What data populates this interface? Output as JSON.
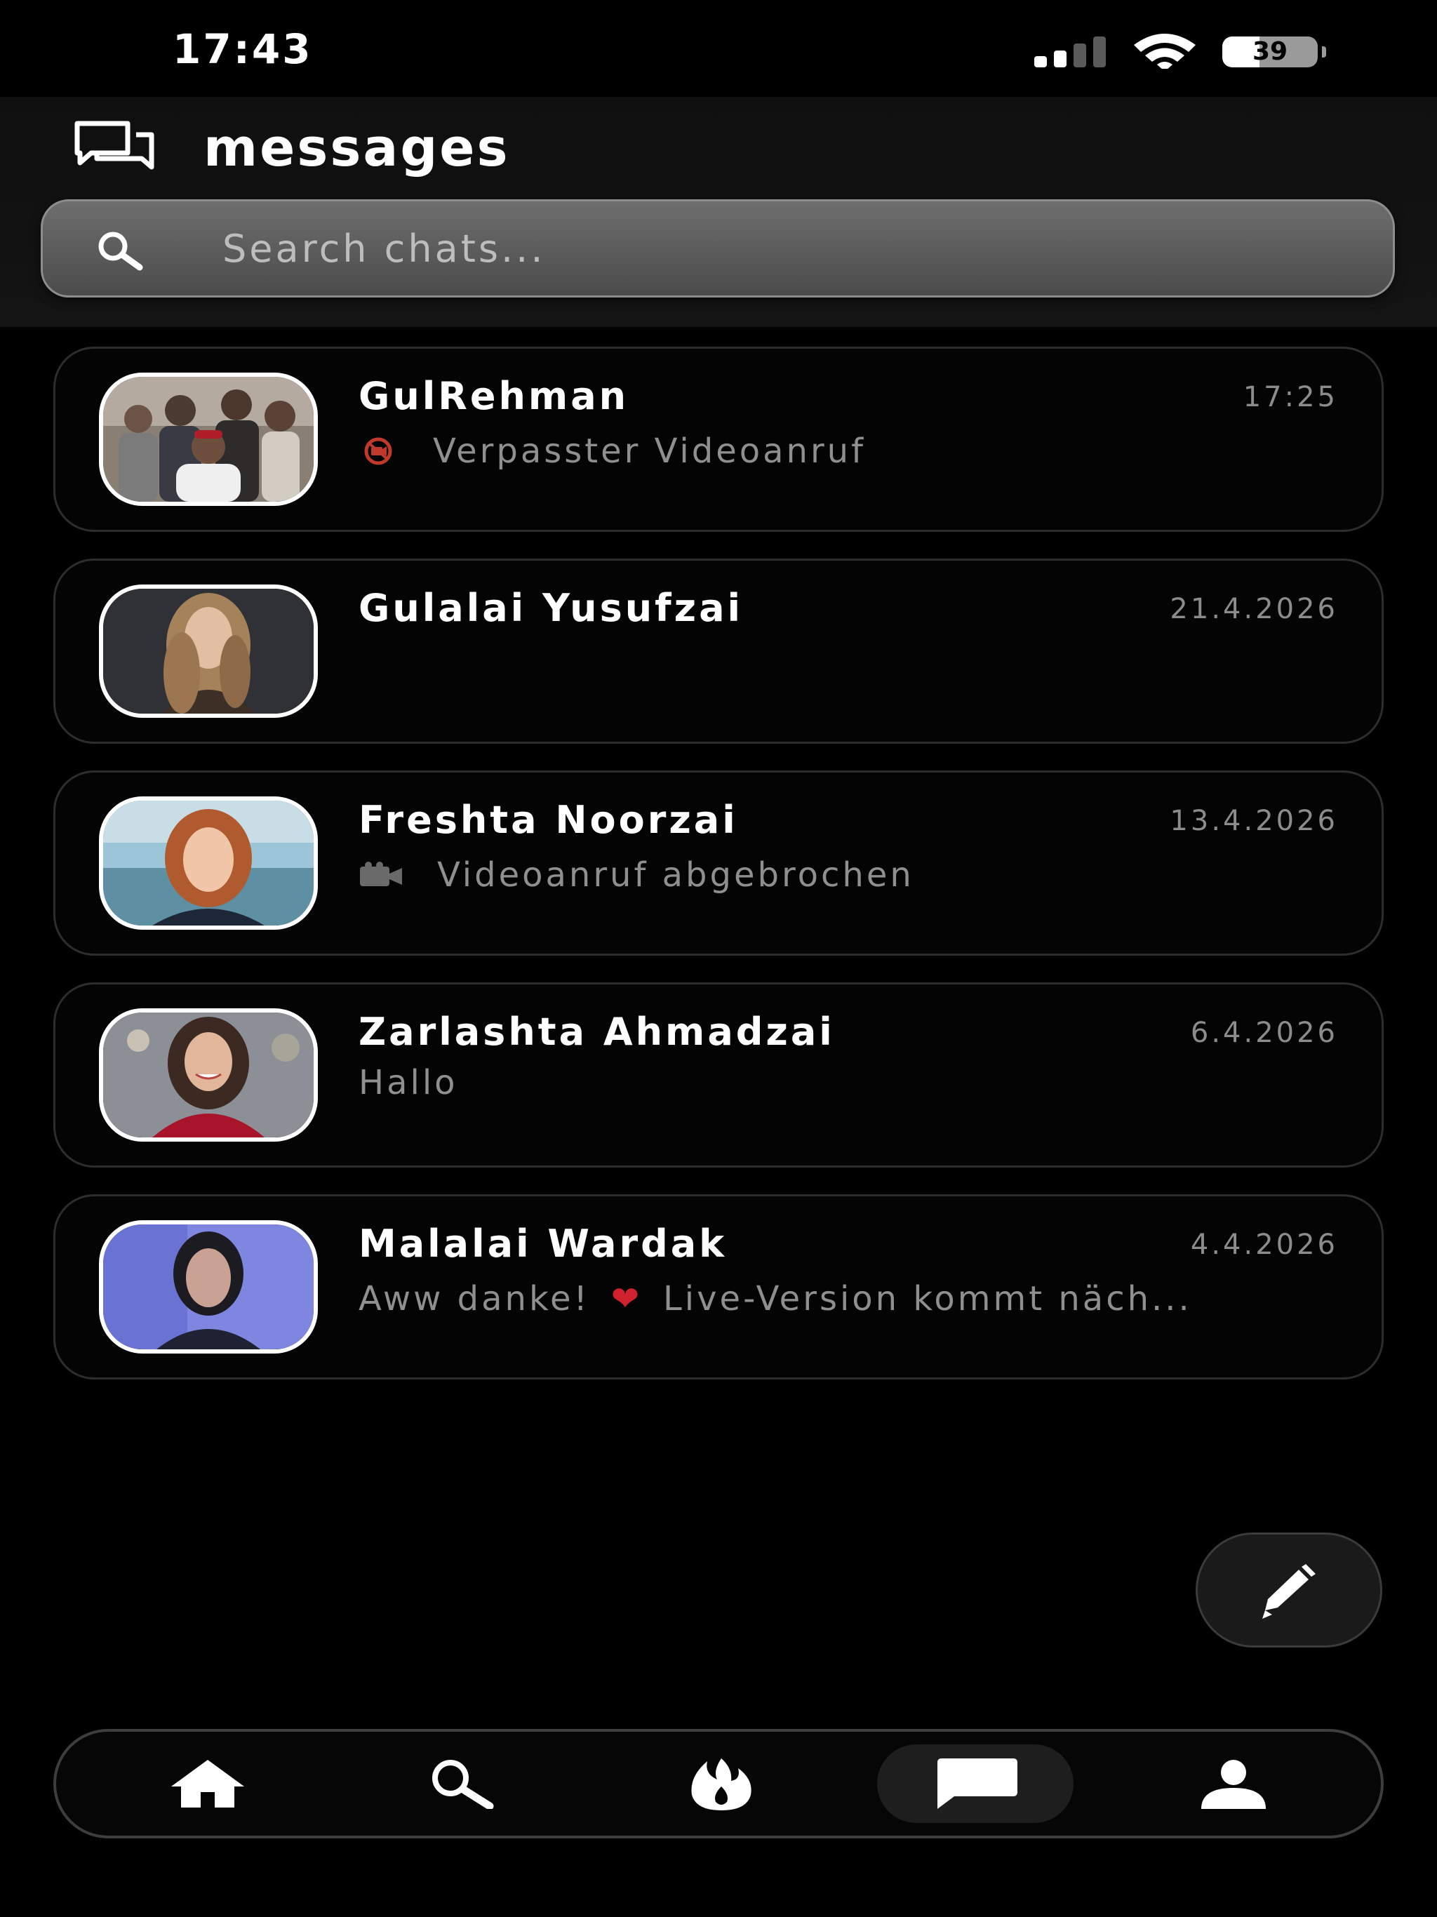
{
  "status_bar": {
    "time": "17:43",
    "battery_level": "39",
    "battery_fraction": 0.39
  },
  "header": {
    "title": "messages",
    "icon": "chat-bubbles-icon"
  },
  "search": {
    "placeholder": "Search chats...",
    "value": ""
  },
  "chats": [
    {
      "name": "GulRehman",
      "time": "17:25",
      "preview_icon": "missed-video-call-icon",
      "preview": "Verpasster Videoanruf"
    },
    {
      "name": "Gulalai Yusufzai",
      "time": "21.4.2026",
      "preview": ""
    },
    {
      "name": "Freshta Noorzai",
      "time": "13.4.2026",
      "preview_icon": "video-camera-icon",
      "preview": "Videoanruf abgebrochen"
    },
    {
      "name": "Zarlashta Ahmadzai",
      "time": "6.4.2026",
      "preview": "Hallo"
    },
    {
      "name": "Malalai Wardak",
      "time": "4.4.2026",
      "preview_before": "Aww danke!",
      "preview_emoji": "❤",
      "preview_after": "Live-Version kommt näch..."
    }
  ],
  "fab": {
    "icon": "pencil-icon"
  },
  "bottom_nav": {
    "items": [
      {
        "icon": "home-icon"
      },
      {
        "icon": "search-icon"
      },
      {
        "icon": "live-flame-icon"
      },
      {
        "icon": "chat-icon",
        "active": true
      },
      {
        "icon": "profile-icon"
      }
    ]
  },
  "colors": {
    "background": "#000000",
    "card_border": "#2d2d2d",
    "muted_text": "#8c8c8c",
    "heart": "#d0212f",
    "missed_call": "#c0392b"
  }
}
